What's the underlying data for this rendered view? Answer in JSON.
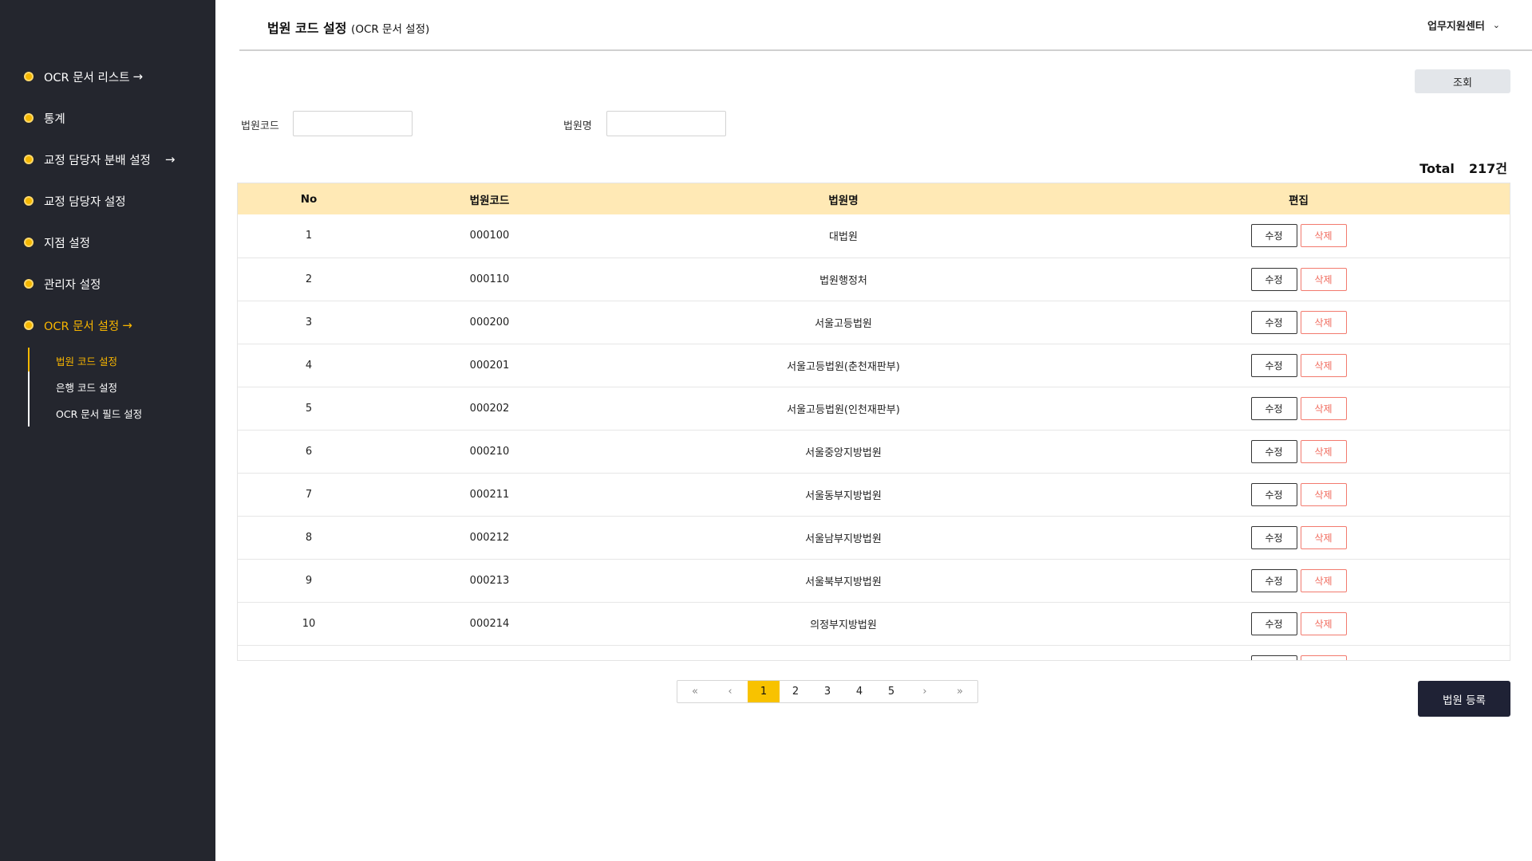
{
  "sidebar": {
    "items": [
      {
        "label": "OCR 문서 리스트",
        "arrow": "→"
      },
      {
        "label": "통계",
        "arrow": ""
      },
      {
        "label": "교정 담당자 분배 설정",
        "arrow": "→"
      },
      {
        "label": "교정 담당자 설정",
        "arrow": ""
      },
      {
        "label": "지점 설정",
        "arrow": ""
      },
      {
        "label": "관리자 설정",
        "arrow": ""
      },
      {
        "label": "OCR 문서 설정",
        "arrow": "→"
      }
    ],
    "sub_items": [
      {
        "label": "법원 코드 설정"
      },
      {
        "label": "은행 코드 설정"
      },
      {
        "label": "OCR 문서 필드 설정"
      }
    ],
    "accent_color": "#f5b700"
  },
  "header": {
    "title": "법원 코드 설정",
    "subtitle": "(OCR 문서 설정)",
    "center_select": "업무지원센터",
    "chevron": "⌄"
  },
  "search": {
    "button_label": "조회",
    "code_label": "법원코드",
    "code_value": "",
    "name_label": "법원명",
    "name_value": ""
  },
  "total": {
    "label": "Total",
    "count": "217건"
  },
  "table": {
    "columns": [
      "No",
      "법원코드",
      "법원명",
      "편집"
    ],
    "edit_label": "수정",
    "delete_label": "삭제",
    "rows": [
      {
        "no": "1",
        "code": "000100",
        "name": "대법원"
      },
      {
        "no": "2",
        "code": "000110",
        "name": "법원행정처"
      },
      {
        "no": "3",
        "code": "000200",
        "name": "서울고등법원"
      },
      {
        "no": "4",
        "code": "000201",
        "name": "서울고등법원(춘천재판부)"
      },
      {
        "no": "5",
        "code": "000202",
        "name": "서울고등법원(인천재판부)"
      },
      {
        "no": "6",
        "code": "000210",
        "name": "서울중앙지방법원"
      },
      {
        "no": "7",
        "code": "000211",
        "name": "서울동부지방법원"
      },
      {
        "no": "8",
        "code": "000212",
        "name": "서울남부지방법원"
      },
      {
        "no": "9",
        "code": "000213",
        "name": "서울북부지방법원"
      },
      {
        "no": "10",
        "code": "000214",
        "name": "의정부지방법원"
      },
      {
        "no": "",
        "code": "",
        "name": ""
      }
    ],
    "header_color": "#ffe9b5"
  },
  "pagination": {
    "first": "«",
    "prev": "‹",
    "pages": [
      "1",
      "2",
      "3",
      "4",
      "5"
    ],
    "current": "1",
    "next": "›",
    "last": "»",
    "active_color": "#f8c200"
  },
  "register_button": "법원 등록"
}
